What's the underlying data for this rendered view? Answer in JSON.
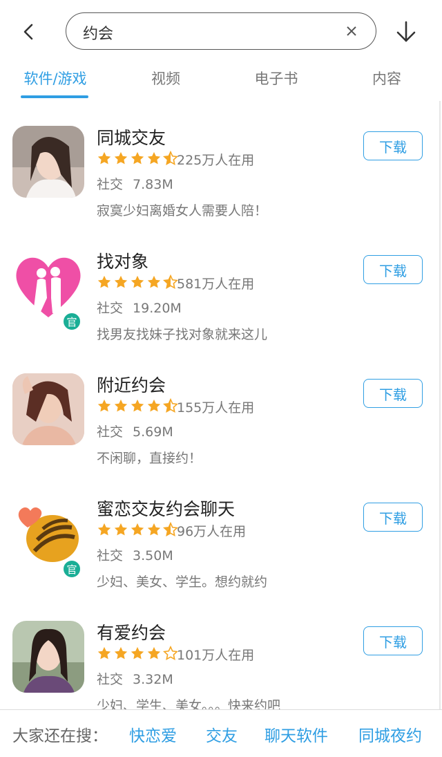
{
  "search": {
    "query": "约会"
  },
  "icons": {
    "back": "back-chevron-icon",
    "clear": "close-icon",
    "download": "download-arrow-icon"
  },
  "tabs": [
    {
      "label": "软件/游戏",
      "active": true
    },
    {
      "label": "视频",
      "active": false
    },
    {
      "label": "电子书",
      "active": false
    },
    {
      "label": "内容",
      "active": false
    }
  ],
  "colors": {
    "accent": "#2f9ee3",
    "star": "#f5a623",
    "official_badge": "#1aae96"
  },
  "apps": [
    {
      "name": "同城交友",
      "rating": 4.5,
      "users": "225万人在用",
      "category": "社交",
      "size": "7.83M",
      "description": "寂寞少妇离婚女人需要人陪！",
      "official": false,
      "icon": "portrait-photo-icon",
      "button": "下载"
    },
    {
      "name": "找对象",
      "rating": 4.5,
      "users": "581万人在用",
      "category": "社交",
      "size": "19.20M",
      "description": "找男友找妹子找对象就来这儿",
      "official": true,
      "icon": "pink-heart-couple-icon",
      "button": "下载"
    },
    {
      "name": "附近约会",
      "rating": 4.5,
      "users": "155万人在用",
      "category": "社交",
      "size": "5.69M",
      "description": "不闲聊，直接约！",
      "official": false,
      "icon": "portrait-photo-icon",
      "button": "下载"
    },
    {
      "name": "蜜恋交友约会聊天",
      "rating": 4.5,
      "users": "96万人在用",
      "category": "社交",
      "size": "3.50M",
      "description": "少妇、美女、学生。想约就约",
      "official": true,
      "icon": "orange-shell-heart-icon",
      "button": "下载"
    },
    {
      "name": "有爱约会",
      "rating": 4.0,
      "users": "101万人在用",
      "category": "社交",
      "size": "3.32M",
      "description": "少妇、学生、美女。。。快来约吧",
      "official": false,
      "icon": "portrait-photo-icon",
      "button": "下载"
    }
  ],
  "official_badge_label": "官",
  "bottom": {
    "label": "大家还在搜：",
    "related": [
      "快恋爱",
      "交友",
      "聊天软件",
      "同城夜约"
    ]
  }
}
